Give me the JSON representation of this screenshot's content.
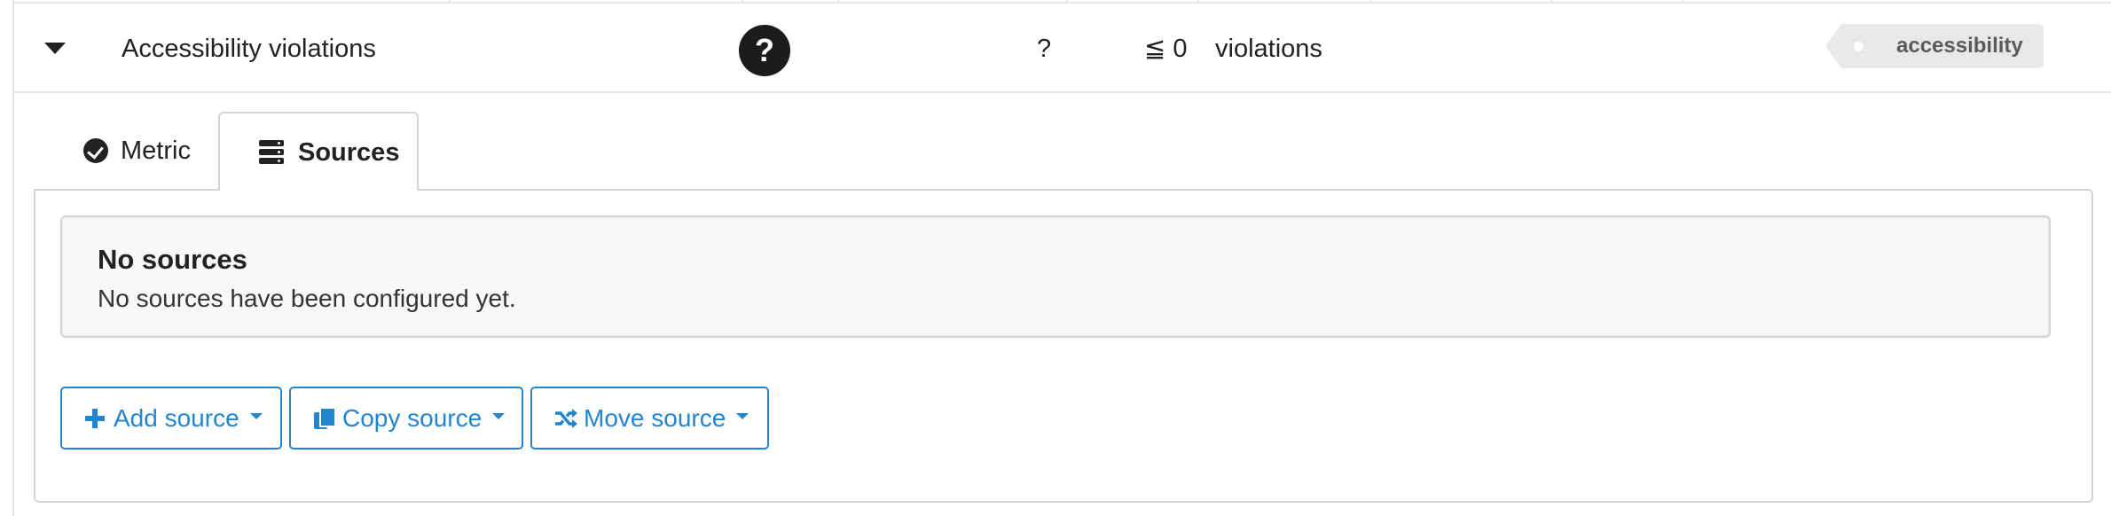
{
  "metric_row": {
    "name": "Accessibility violations",
    "status_icon": "question-circle-icon",
    "status_symbol": "?",
    "measurement": "?",
    "target": "≦ 0",
    "unit": "violations",
    "tag": "accessibility"
  },
  "tabs": [
    {
      "label": "Metric",
      "icon": "check-circle-icon",
      "active": false
    },
    {
      "label": "Sources",
      "icon": "server-icon",
      "active": true
    }
  ],
  "message": {
    "header": "No sources",
    "body": "No sources have been configured yet."
  },
  "buttons": {
    "add": {
      "label": "Add source",
      "icon": "plus-icon"
    },
    "copy": {
      "label": "Copy source",
      "icon": "copy-icon"
    },
    "move": {
      "label": "Move source",
      "icon": "shuffle-icon"
    }
  },
  "colors": {
    "accent": "#2185d0",
    "status_icon_bg": "#1b1c1d",
    "tag_bg": "#e8e8e8"
  }
}
